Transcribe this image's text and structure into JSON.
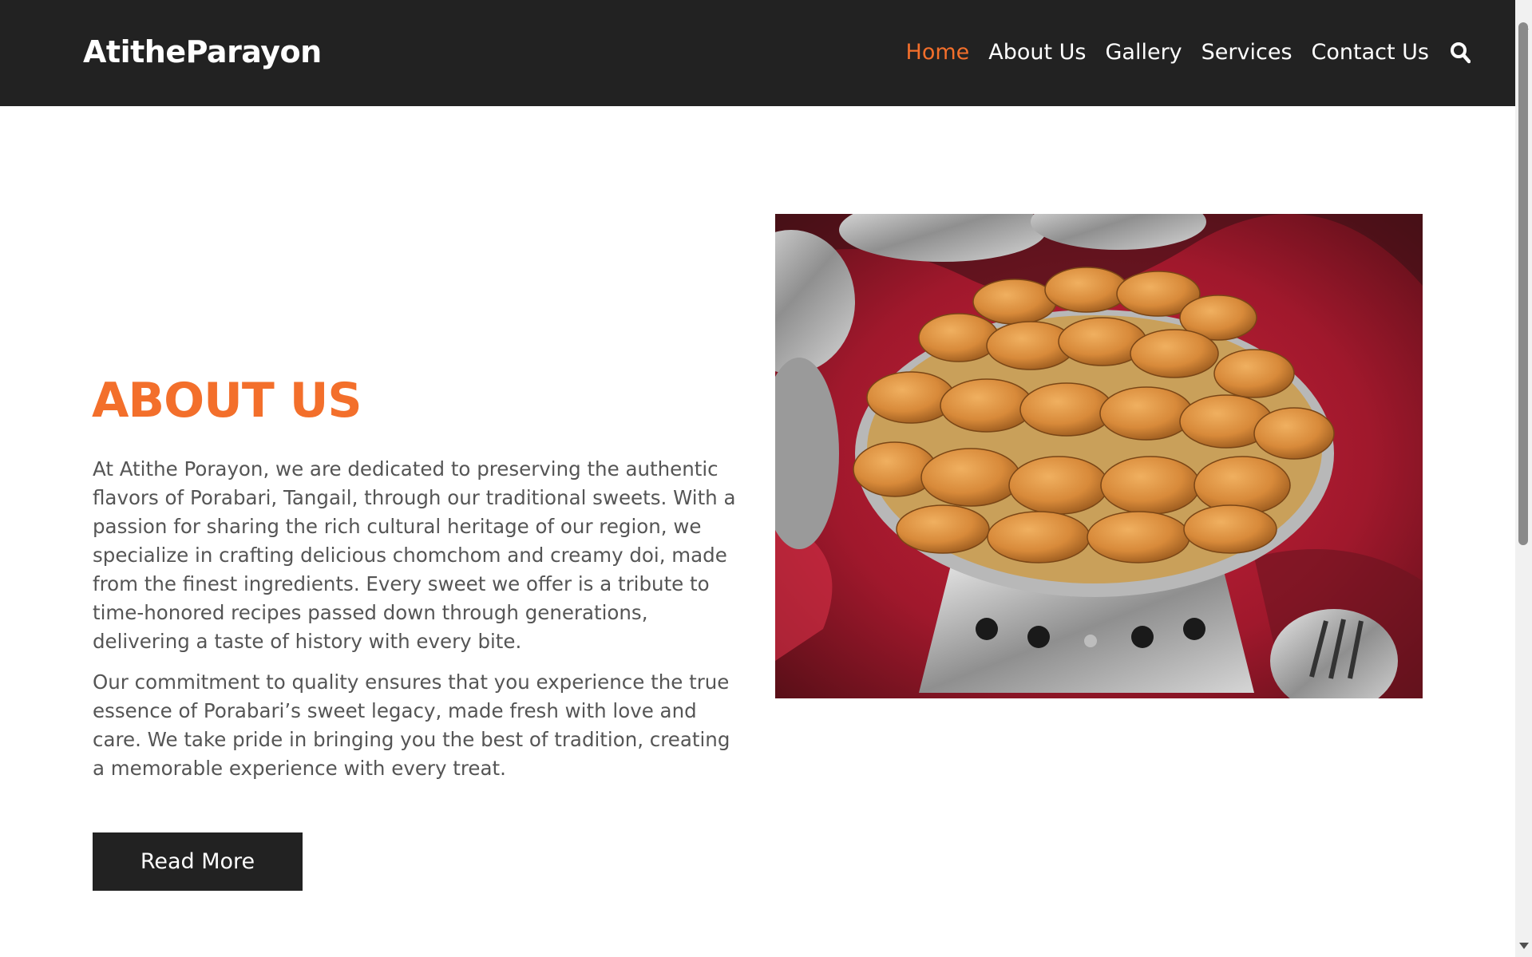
{
  "brand": {
    "logo_text": "AtitheParayon"
  },
  "nav": {
    "items": [
      {
        "label": "Home",
        "active": true
      },
      {
        "label": "About Us",
        "active": false
      },
      {
        "label": "Gallery",
        "active": false
      },
      {
        "label": "Services",
        "active": false
      },
      {
        "label": "Contact Us",
        "active": false
      }
    ],
    "search_icon": "search-icon"
  },
  "about": {
    "title": "ABOUT US",
    "paragraph1": "At Atithe Porayon, we are dedicated to preserving the authentic flavors of Porabari, Tangail, through our traditional sweets. With a passion for sharing the rich cultural heritage of our region, we specialize in crafting delicious chomchom and creamy doi, made from the finest ingredients. Every sweet we offer is a tribute to time-honored recipes passed down through generations, delivering a taste of history with every bite.",
    "paragraph2": "Our commitment to quality ensures that you experience the true essence of Porabari’s sweet legacy, made fresh with love and care. We take pride in bringing you the best of tradition, creating a memorable experience with every treat.",
    "button_label": "Read More"
  },
  "colors": {
    "accent": "#f36f2b",
    "header_bg": "#222222",
    "text": "#555555",
    "button_bg": "#222222"
  }
}
